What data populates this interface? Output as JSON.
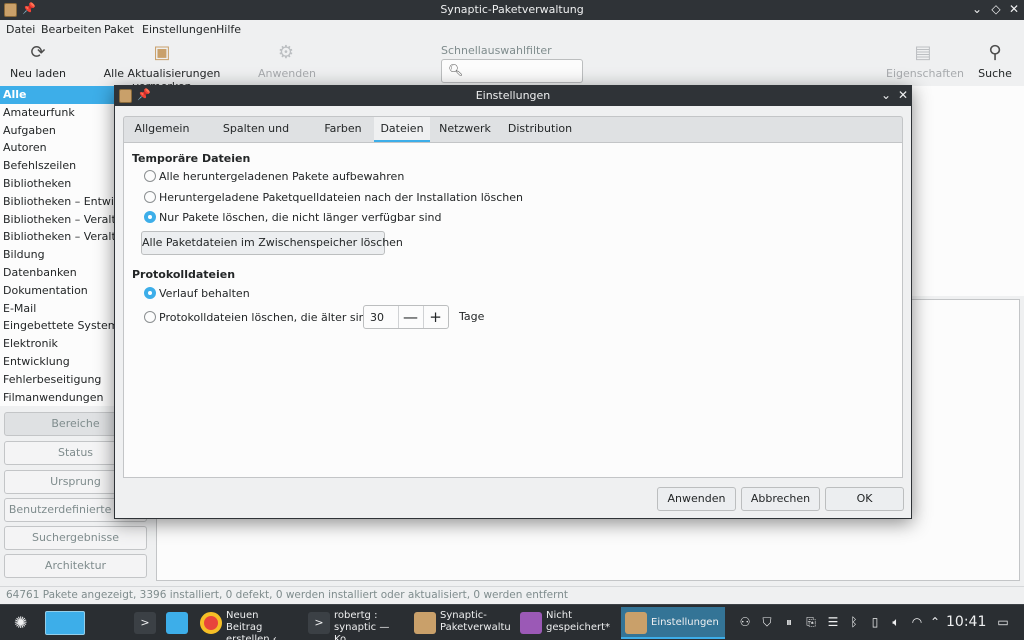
{
  "window": {
    "title": "Synaptic-Paketverwaltung",
    "controls": {
      "minimize": "⌄",
      "maximize": "◇",
      "close": "✕"
    }
  },
  "menubar": [
    "Datei",
    "Bearbeiten",
    "Paket",
    "Einstellungen",
    "Hilfe"
  ],
  "toolbar": {
    "reload": "Neu laden",
    "mark_all_upgrades": "Alle Aktualisierungen vormerken",
    "apply": "Anwenden",
    "quickfilter_label": "Schnellauswahlfilter",
    "quickfilter_value": "",
    "properties": "Eigenschaften",
    "search": "Suche"
  },
  "sidebar": {
    "sections": [
      "Alle",
      "Amateurfunk",
      "Aufgaben",
      "Autoren",
      "Befehlszeilen",
      "Bibliotheken",
      "Bibliotheken – Entwicklung",
      "Bibliotheken – Veraltet",
      "Bibliotheken – Veraltet (",
      "Bildung",
      "Datenbanken",
      "Dokumentation",
      "E-Mail",
      "Eingebettete Systeme",
      "Elektronik",
      "Entwicklung",
      "Fehlerbeseitigung",
      "Filmanwendungen"
    ],
    "selected_index": 0,
    "filters": [
      "Bereiche",
      "Status",
      "Ursprung",
      "Benutzerdefinierte Filter",
      "Suchergebnisse",
      "Architektur"
    ]
  },
  "statusbar": "64761 Pakete angezeigt, 3396 installiert, 0 defekt, 0 werden installiert oder aktualisiert, 0 werden entfernt",
  "dialog": {
    "title": "Einstellungen",
    "controls": {
      "minimize": "⌄",
      "close": "✕"
    },
    "tabs": [
      "Allgemein",
      "Spalten und Schriften",
      "Farben",
      "Dateien",
      "Netzwerk",
      "Distribution"
    ],
    "active_tab": "Dateien",
    "temp_files": {
      "title": "Temporäre Dateien",
      "options": [
        {
          "label": "Alle heruntergeladenen Pakete aufbewahren",
          "selected": false
        },
        {
          "label": "Heruntergeladene Paketquelldateien nach der Installation löschen",
          "selected": false
        },
        {
          "label": "Nur Pakete löschen, die nicht länger verfügbar sind",
          "selected": true
        }
      ],
      "clear_cache_button": "Alle Paketdateien im Zwischenspeicher löschen"
    },
    "log_files": {
      "title": "Protokolldateien",
      "keep_history": {
        "label": "Verlauf behalten",
        "selected": true
      },
      "delete_older": {
        "label": "Protokolldateien löschen, die älter sind als:",
        "selected": false
      },
      "days_value": "30",
      "days_unit": "Tage",
      "minus": "—",
      "plus": "+"
    },
    "buttons": {
      "apply": "Anwenden",
      "cancel": "Abbrechen",
      "ok": "OK"
    }
  },
  "taskbar": {
    "tasks": [
      {
        "label": "Neuen Beitrag\nerstellen ‹ Linu...",
        "active": false
      },
      {
        "label": "robertg :\nsynaptic — Ko...",
        "active": false
      },
      {
        "label": "Synaptic-\nPaketverwaltu...",
        "active": false
      },
      {
        "label": "Nicht\ngespeichert* ...",
        "active": false
      },
      {
        "label": "Einstellungen",
        "active": true
      }
    ],
    "clock": "10:41"
  },
  "colors": {
    "accent": "#3daee9",
    "titlebar": "#2f3337",
    "window_bg": "#eff0f1",
    "taskbar": "#2a2e32"
  }
}
